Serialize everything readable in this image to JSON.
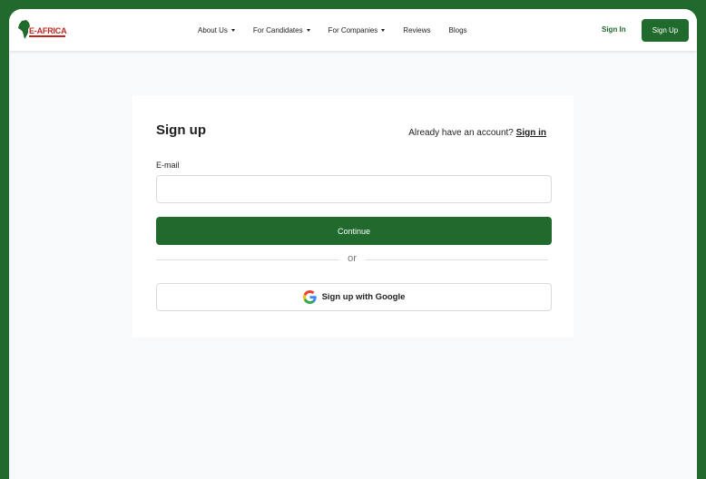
{
  "brand": {
    "logo_text": "E-AFRICA",
    "primary_color": "#1f6a2c",
    "logo_color": "#c0281d"
  },
  "nav": {
    "items": [
      {
        "label": "About Us",
        "dropdown": true
      },
      {
        "label": "For Candidates",
        "dropdown": true
      },
      {
        "label": "For Companies",
        "dropdown": true
      },
      {
        "label": "Reviews",
        "dropdown": false
      },
      {
        "label": "Blogs",
        "dropdown": false
      }
    ],
    "sign_in_label": "Sign In",
    "sign_up_label": "Sign Up"
  },
  "form": {
    "title": "Sign up",
    "account_prompt": "Already have an account?",
    "sign_in_link": "Sign in",
    "email_label": "E-mail",
    "email_placeholder": "",
    "email_value": "",
    "continue_label": "Continue",
    "divider_text": "or",
    "google_label": "Sign up with Google",
    "google_icon": "google-g-icon"
  }
}
